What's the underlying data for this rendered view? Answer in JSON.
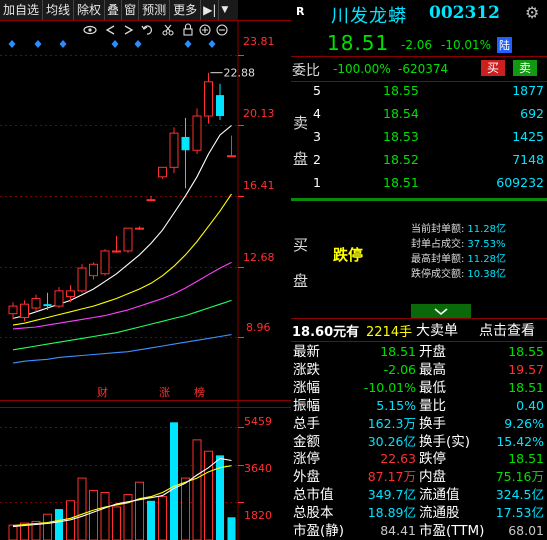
{
  "toolbar": {
    "items": [
      "加自选",
      "均线",
      "除权",
      "叠",
      "窗",
      "预测",
      "更多"
    ],
    "icon_play": "▶|",
    "dropdown": "▼"
  },
  "chart_tools": {
    "icons": [
      "eye-icon",
      "left-arrow-icon",
      "right-arrow-icon",
      "undo-icon",
      "scissors-icon",
      "lock-icon",
      "zoom-in-icon",
      "zoom-out-icon"
    ]
  },
  "price_axis": [
    "23.81",
    "20.13",
    "16.41",
    "12.68",
    "8.96"
  ],
  "peak_label": "22.88",
  "markers": [
    "财",
    "涨",
    "榜"
  ],
  "volume_axis": [
    "5459",
    "3640",
    "1820"
  ],
  "chart_data": {
    "type": "candlestick",
    "candles": [
      {
        "o": 10.2,
        "h": 10.8,
        "l": 9.9,
        "c": 10.6
      },
      {
        "o": 10.0,
        "h": 10.9,
        "l": 9.8,
        "c": 10.7
      },
      {
        "o": 10.5,
        "h": 11.2,
        "l": 10.3,
        "c": 11.0
      },
      {
        "o": 10.7,
        "h": 11.3,
        "l": 10.4,
        "c": 10.6
      },
      {
        "o": 10.6,
        "h": 11.6,
        "l": 10.5,
        "c": 11.4
      },
      {
        "o": 11.1,
        "h": 11.7,
        "l": 10.8,
        "c": 11.4
      },
      {
        "o": 11.4,
        "h": 12.8,
        "l": 11.3,
        "c": 12.6
      },
      {
        "o": 12.2,
        "h": 12.9,
        "l": 12.0,
        "c": 12.8
      },
      {
        "o": 12.3,
        "h": 13.6,
        "l": 12.2,
        "c": 13.5
      },
      {
        "o": 13.5,
        "h": 14.3,
        "l": 13.4,
        "c": 13.5
      },
      {
        "o": 13.5,
        "h": 14.7,
        "l": 13.4,
        "c": 14.7
      },
      {
        "o": 14.7,
        "h": 14.8,
        "l": 14.6,
        "c": 14.7
      },
      {
        "o": 16.2,
        "h": 16.4,
        "l": 16.1,
        "c": 16.2
      },
      {
        "o": 17.4,
        "h": 17.9,
        "l": 17.3,
        "c": 17.9
      },
      {
        "o": 17.9,
        "h": 20.0,
        "l": 17.6,
        "c": 19.7
      },
      {
        "o": 19.5,
        "h": 20.5,
        "l": 16.8,
        "c": 18.8
      },
      {
        "o": 18.8,
        "h": 21.0,
        "l": 18.6,
        "c": 20.6
      },
      {
        "o": 20.6,
        "h": 22.88,
        "l": 20.2,
        "c": 22.4
      },
      {
        "o": 21.7,
        "h": 22.3,
        "l": 20.4,
        "c": 20.6
      },
      {
        "o": 18.51,
        "h": 19.57,
        "l": 18.51,
        "c": 18.51
      }
    ],
    "ma": [
      {
        "color": "#ffffff",
        "values": [
          9.95,
          10.1,
          10.3,
          10.5,
          10.7,
          10.9,
          11.2,
          11.5,
          11.9,
          12.3,
          12.8,
          13.3,
          13.9,
          14.6,
          15.5,
          16.4,
          17.4,
          18.6,
          19.6,
          20.1
        ]
      },
      {
        "color": "#ffff00",
        "values": [
          9.6,
          9.7,
          9.85,
          10.0,
          10.15,
          10.3,
          10.45,
          10.6,
          10.8,
          11.0,
          11.25,
          11.5,
          11.8,
          12.2,
          12.7,
          13.3,
          14.0,
          14.8,
          15.6,
          16.5
        ]
      },
      {
        "color": "#ff40ff",
        "values": [
          9.4,
          9.45,
          9.5,
          9.6,
          9.7,
          9.8,
          9.9,
          10.0,
          10.1,
          10.25,
          10.4,
          10.6,
          10.8,
          11.0,
          11.25,
          11.55,
          11.9,
          12.25,
          12.6,
          12.9
        ]
      },
      {
        "color": "#20ff60",
        "values": [
          8.3,
          8.4,
          8.5,
          8.6,
          8.7,
          8.8,
          8.9,
          9.0,
          9.1,
          9.2,
          9.35,
          9.5,
          9.65,
          9.8,
          9.95,
          10.1,
          10.3,
          10.5,
          10.7,
          10.9
        ]
      },
      {
        "color": "#4090ff",
        "values": [
          7.6,
          7.7,
          7.75,
          7.8,
          7.9,
          7.95,
          8.0,
          8.05,
          8.1,
          8.15,
          8.2,
          8.3,
          8.4,
          8.5,
          8.6,
          8.7,
          8.8,
          8.9,
          9.0,
          9.1
        ]
      }
    ],
    "volume": [
      {
        "v": 720,
        "up": true
      },
      {
        "v": 820,
        "up": true
      },
      {
        "v": 900,
        "up": true
      },
      {
        "v": 1250,
        "up": true
      },
      {
        "v": 1500,
        "up": false
      },
      {
        "v": 1900,
        "up": true
      },
      {
        "v": 3000,
        "up": true
      },
      {
        "v": 2400,
        "up": true
      },
      {
        "v": 2300,
        "up": true
      },
      {
        "v": 1600,
        "up": true
      },
      {
        "v": 2200,
        "up": true
      },
      {
        "v": 2800,
        "up": true
      },
      {
        "v": 1900,
        "up": false
      },
      {
        "v": 2100,
        "up": true
      },
      {
        "v": 5700,
        "up": false
      },
      {
        "v": 3000,
        "up": true
      },
      {
        "v": 4850,
        "up": true
      },
      {
        "v": 4300,
        "up": true
      },
      {
        "v": 4100,
        "up": false
      },
      {
        "v": 1100,
        "up": false
      }
    ],
    "vol_ma": [
      {
        "color": "#ffff00",
        "values": [
          700,
          750,
          800,
          850,
          950,
          1050,
          1250,
          1450,
          1600,
          1700,
          1800,
          2000,
          2100,
          2300,
          2600,
          2800,
          3000,
          3300,
          3500,
          3600
        ]
      },
      {
        "color": "#ffffff",
        "values": [
          650,
          700,
          750,
          800,
          880,
          980,
          1150,
          1350,
          1550,
          1750,
          1850,
          1950,
          2050,
          2150,
          2500,
          2750,
          3150,
          3500,
          3950,
          3850
        ]
      }
    ],
    "ylim": [
      7.5,
      24.6
    ],
    "vlim": [
      0,
      6200
    ]
  },
  "stock": {
    "marker": "R",
    "name": "川发龙蟒",
    "code": "002312",
    "price": "18.51",
    "change": "-2.06",
    "pct": "-10.01%",
    "tag": "陆"
  },
  "weibi": {
    "label": "委比",
    "pct": "-100.00%",
    "diff": "-620374",
    "buy_btn": "买",
    "sell_btn": "卖"
  },
  "sell_side": {
    "label_top": "卖",
    "label_bottom": "盘",
    "rows": [
      {
        "lv": "5",
        "price": "18.55",
        "vol": "1877"
      },
      {
        "lv": "4",
        "price": "18.54",
        "vol": "692"
      },
      {
        "lv": "3",
        "price": "18.53",
        "vol": "1425"
      },
      {
        "lv": "2",
        "price": "18.52",
        "vol": "7148"
      },
      {
        "lv": "1",
        "price": "18.51",
        "vol": "609232"
      }
    ]
  },
  "buy_side": {
    "label_top": "买",
    "label_bottom": "盘",
    "status": "跌停",
    "info": [
      {
        "label": "当前封单额:",
        "value": "11.28亿"
      },
      {
        "label": "封单占成交:",
        "value": "37.53%"
      },
      {
        "label": "最高封单额:",
        "value": "11.28亿"
      },
      {
        "label": "跌停成交额:",
        "value": "10.38亿"
      }
    ]
  },
  "big_order": {
    "price": "18.60元有",
    "vol": "2214手",
    "label": "大卖单",
    "link": "点击查看"
  },
  "quotes": [
    {
      "l1": "最新",
      "v1": "18.51",
      "c1": "c-grn",
      "l2": "开盘",
      "v2": "18.55",
      "c2": "c-grn"
    },
    {
      "l1": "涨跌",
      "v1": "-2.06",
      "c1": "c-grn",
      "l2": "最高",
      "v2": "19.57",
      "c2": "c-red"
    },
    {
      "l1": "涨幅",
      "v1": "-10.01%",
      "c1": "c-grn",
      "l2": "最低",
      "v2": "18.51",
      "c2": "c-grn"
    },
    {
      "l1": "振幅",
      "v1": "5.15%",
      "c1": "c-cyan",
      "l2": "量比",
      "v2": "0.40",
      "c2": "c-cyan"
    },
    {
      "l1": "总手",
      "v1": "162.3万",
      "c1": "c-cyan",
      "l2": "换手",
      "v2": "9.26%",
      "c2": "c-cyan"
    },
    {
      "l1": "金额",
      "v1": "30.26亿",
      "c1": "c-cyan",
      "l2": "换手(实)",
      "v2": "15.42%",
      "c2": "c-cyan"
    },
    {
      "l1": "涨停",
      "v1": "22.63",
      "c1": "c-red",
      "l2": "跌停",
      "v2": "18.51",
      "c2": "c-grn"
    },
    {
      "l1": "外盘",
      "v1": "87.17万",
      "c1": "c-red",
      "l2": "内盘",
      "v2": "75.16万",
      "c2": "c-grn"
    },
    {
      "l1": "总市值",
      "v1": "349.7亿",
      "c1": "c-cyan",
      "l2": "流通值",
      "v2": "324.5亿",
      "c2": "c-cyan"
    },
    {
      "l1": "总股本",
      "v1": "18.89亿",
      "c1": "c-cyan",
      "l2": "流通股",
      "v2": "17.53亿",
      "c2": "c-cyan"
    },
    {
      "l1": "市盈(静)",
      "v1": "84.41",
      "c1": "c-gray",
      "l2": "市盈(TTM)",
      "v2": "68.01",
      "c2": "c-gray"
    }
  ],
  "colors": {
    "up": "#ff3030",
    "down": "#00e5ff",
    "grid": "#7a0000",
    "accent": "#00e000"
  }
}
